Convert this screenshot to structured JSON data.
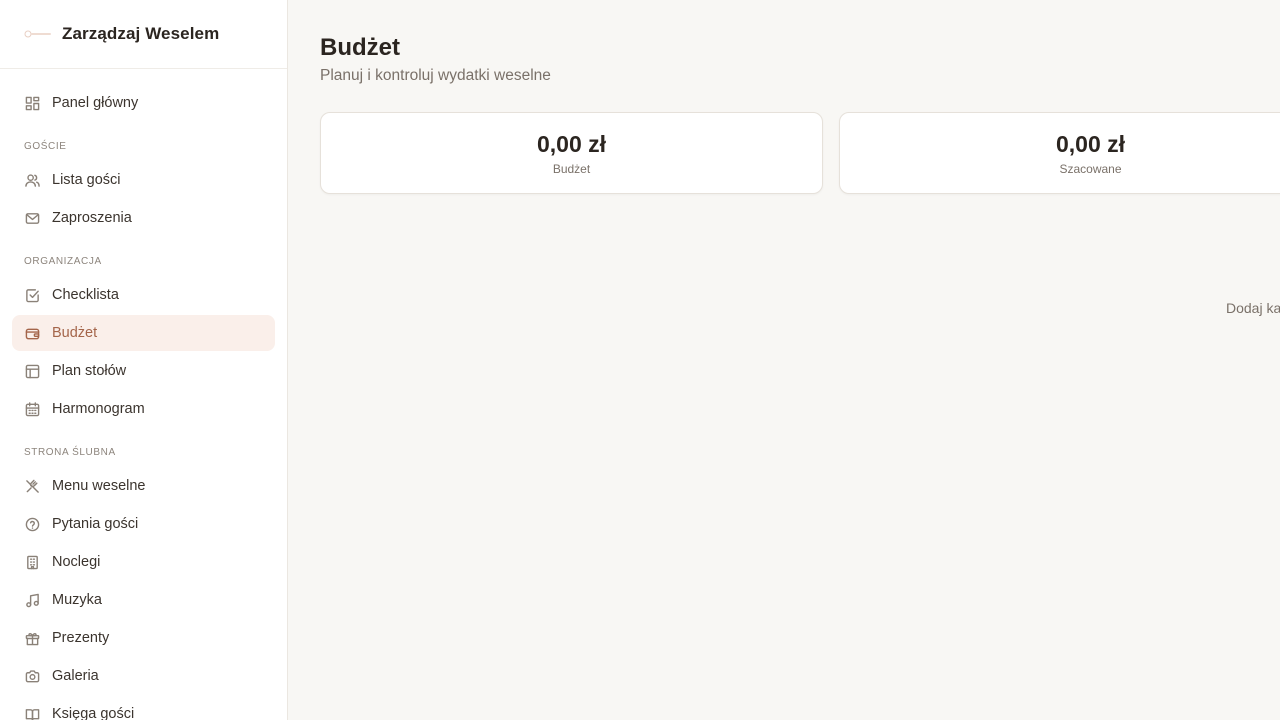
{
  "app": {
    "title": "Zarządzaj Weselem"
  },
  "sidebar": {
    "top_item": {
      "label": "Panel główny",
      "icon": "dashboard-icon"
    },
    "sections": [
      {
        "label": "Goście",
        "items": [
          {
            "label": "Lista gości",
            "icon": "users-icon"
          },
          {
            "label": "Zaproszenia",
            "icon": "mail-icon"
          }
        ]
      },
      {
        "label": "Organizacja",
        "items": [
          {
            "label": "Checklista",
            "icon": "checkbox-icon"
          },
          {
            "label": "Budżet",
            "icon": "wallet-icon",
            "active": true
          },
          {
            "label": "Plan stołów",
            "icon": "table-layout-icon"
          },
          {
            "label": "Harmonogram",
            "icon": "calendar-icon"
          }
        ]
      },
      {
        "label": "Strona ślubna",
        "items": [
          {
            "label": "Menu weselne",
            "icon": "utensils-icon"
          },
          {
            "label": "Pytania gości",
            "icon": "help-circle-icon"
          },
          {
            "label": "Noclegi",
            "icon": "building-icon"
          },
          {
            "label": "Muzyka",
            "icon": "music-icon"
          },
          {
            "label": "Prezenty",
            "icon": "gift-icon"
          },
          {
            "label": "Galeria",
            "icon": "camera-icon"
          },
          {
            "label": "Księga gości",
            "icon": "book-icon"
          }
        ]
      }
    ]
  },
  "main": {
    "title": "Budżet",
    "subtitle": "Planuj i kontroluj wydatki weselne",
    "stats": [
      {
        "value": "0,00 zł",
        "label": "Budżet"
      },
      {
        "value": "0,00 zł",
        "label": "Szacowane"
      }
    ],
    "add_hint": "Dodaj ka"
  },
  "colors": {
    "accent": "#a4654a",
    "active_bg": "#faefea",
    "background": "#f8f7f4"
  }
}
